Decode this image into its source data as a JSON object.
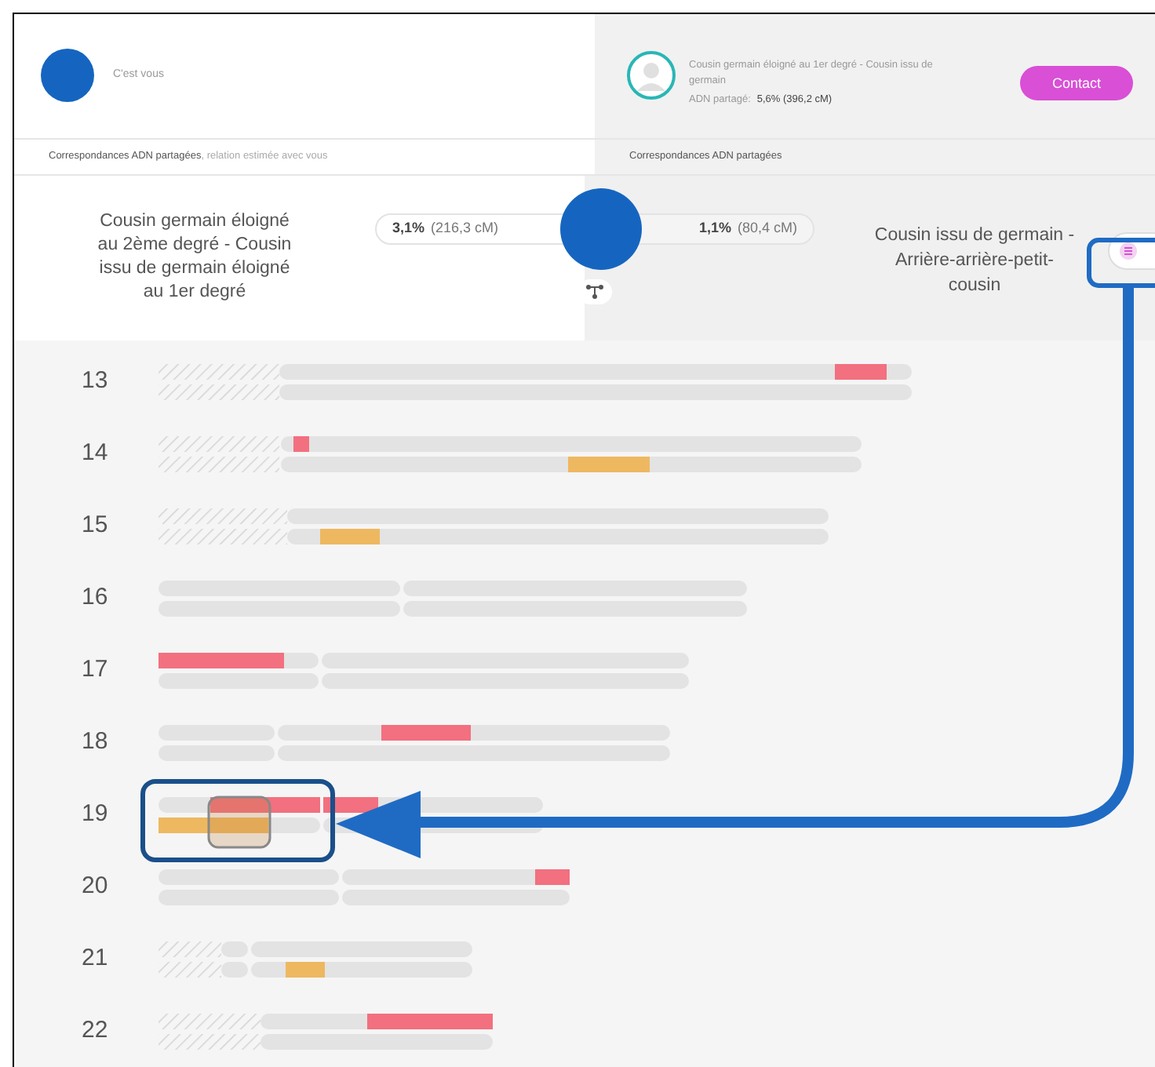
{
  "you": {
    "label": "C'est vous"
  },
  "match": {
    "relation": "Cousin germain éloigné au 1er degré - Cousin issu de germain",
    "shared_label": "ADN partagé:",
    "shared_value": "5,6% (396,2 cM)",
    "contact_button": "Contact"
  },
  "tabs": [
    {
      "label": "Correspondances ADN partagées",
      "suffix": ", relation estimée avec vous"
    },
    {
      "label": "Correspondances ADN partagées"
    }
  ],
  "comparison": {
    "left_relation": "Cousin germain éloigné au 2ème degré - Cousin issu de germain éloigné au 1er degré",
    "left_shared": {
      "percent": "3,1%",
      "cm": "(216,3 cM)"
    },
    "right_shared": {
      "percent": "1,1%",
      "cm": "(80,4 cM)"
    },
    "right_relation": "Cousin issu de germain - Arrière-arrière-petit-cousin"
  },
  "chromosomes": [
    {
      "number": "13"
    },
    {
      "number": "14"
    },
    {
      "number": "15"
    },
    {
      "number": "16"
    },
    {
      "number": "17"
    },
    {
      "number": "18"
    },
    {
      "number": "19"
    },
    {
      "number": "20"
    },
    {
      "number": "21"
    },
    {
      "number": "22"
    }
  ]
}
